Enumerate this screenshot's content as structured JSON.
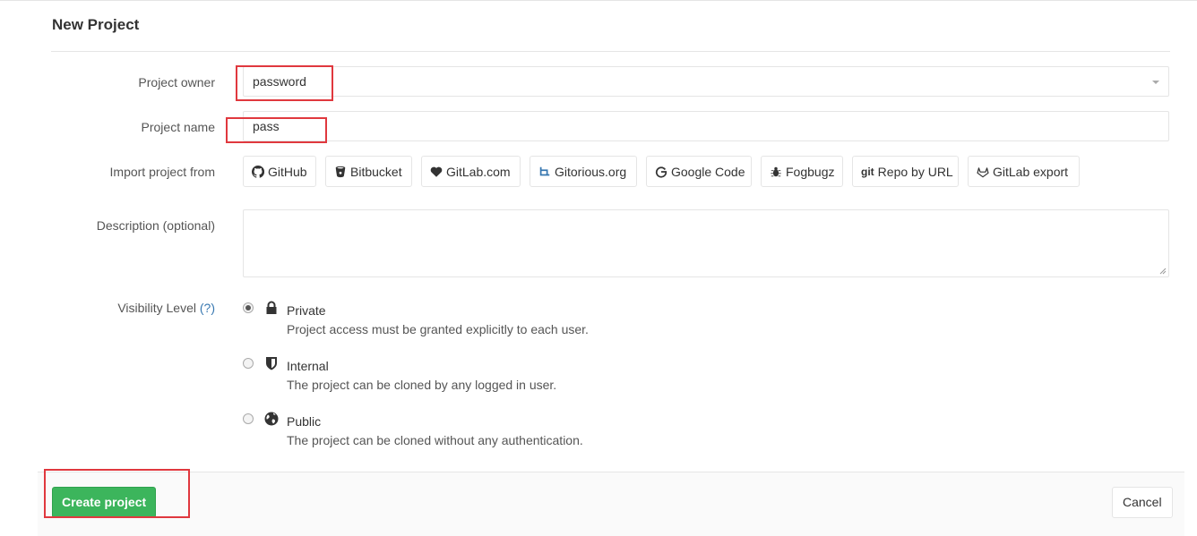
{
  "page": {
    "title": "New Project"
  },
  "form": {
    "owner_label": "Project owner",
    "owner_value": "password",
    "name_label": "Project name",
    "name_value": "pass",
    "import_label": "Import project from",
    "import_sources": [
      {
        "label": "GitHub",
        "icon": "github-icon"
      },
      {
        "label": "Bitbucket",
        "icon": "bitbucket-icon"
      },
      {
        "label": "GitLab.com",
        "icon": "heart-icon"
      },
      {
        "label": "Gitorious.org",
        "icon": "gitorious-icon"
      },
      {
        "label": "Google Code",
        "icon": "google-icon"
      },
      {
        "label": "Fogbugz",
        "icon": "bug-icon"
      },
      {
        "label": "Repo by URL",
        "icon": "git-icon",
        "prefix": "git"
      },
      {
        "label": "GitLab export",
        "icon": "gitlab-icon"
      }
    ],
    "description_label": "Description (optional)",
    "description_value": "",
    "visibility_label": "Visibility Level",
    "visibility_help": "(?)",
    "visibility_options": [
      {
        "title": "Private",
        "description": "Project access must be granted explicitly to each user.",
        "icon": "lock-icon",
        "checked": true
      },
      {
        "title": "Internal",
        "description": "The project can be cloned by any logged in user.",
        "icon": "shield-icon",
        "checked": false
      },
      {
        "title": "Public",
        "description": "The project can be cloned without any authentication.",
        "icon": "globe-icon",
        "checked": false
      }
    ]
  },
  "actions": {
    "create_label": "Create project",
    "cancel_label": "Cancel"
  },
  "colors": {
    "primary_green": "#3cb55c",
    "highlight_red": "#e0383e",
    "link_blue": "#3777b0"
  }
}
